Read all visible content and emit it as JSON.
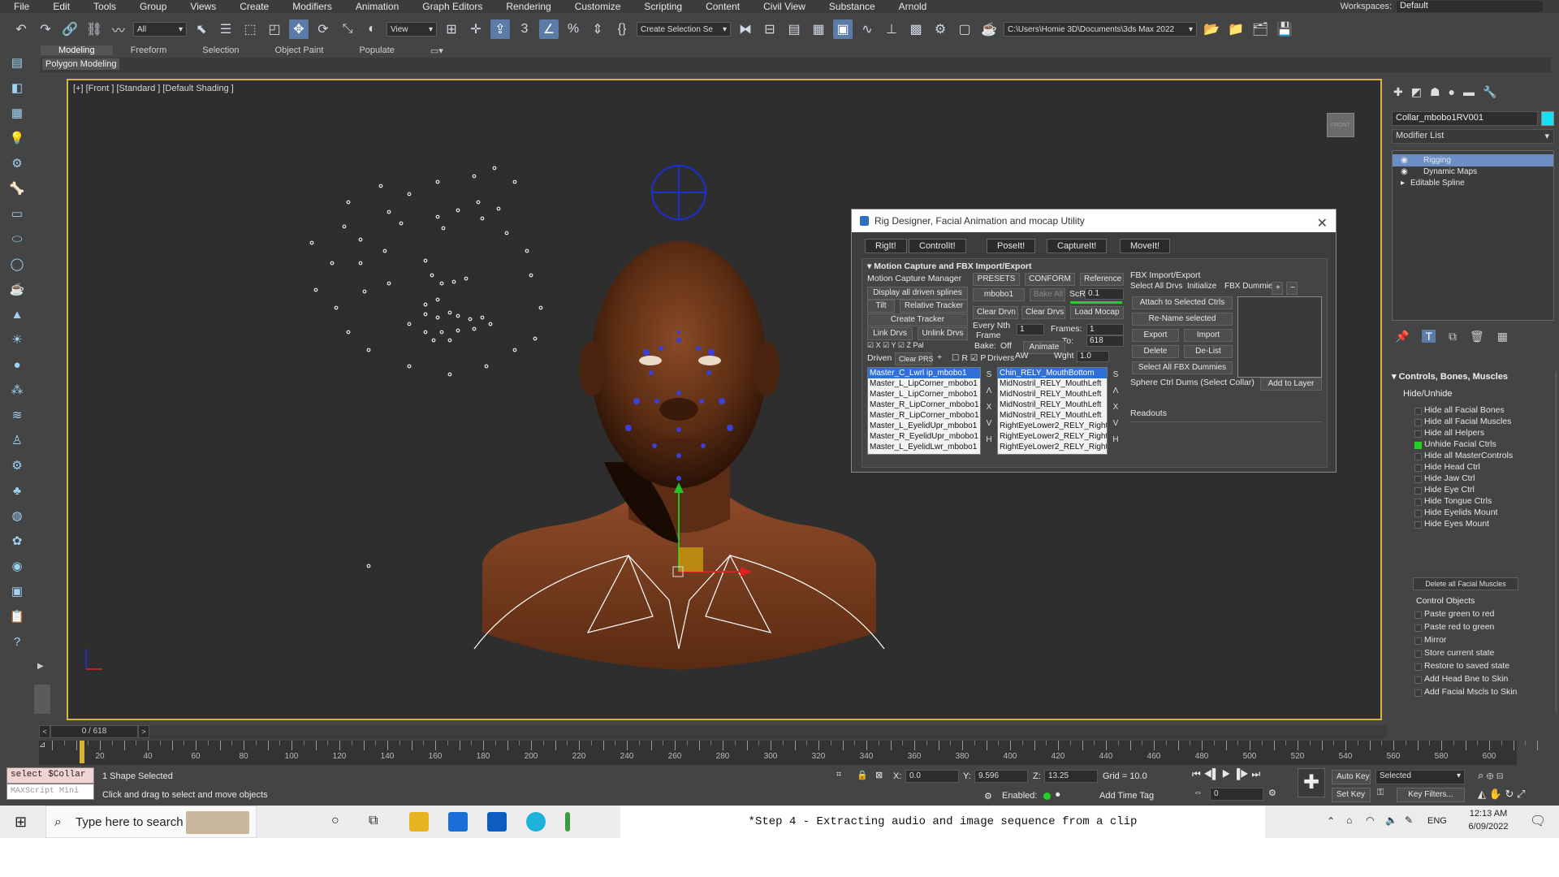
{
  "menu": [
    "File",
    "Edit",
    "Tools",
    "Group",
    "Views",
    "Create",
    "Modifiers",
    "Animation",
    "Graph Editors",
    "Rendering",
    "Customize",
    "Scripting",
    "Content",
    "Civil View",
    "Substance",
    "Arnold"
  ],
  "workspace": {
    "label": "Workspaces:",
    "value": "Default"
  },
  "toolbar": {
    "filter_value": "All",
    "refcoord_value": "View",
    "selection_set_placeholder": "Create Selection Se",
    "project_path": "C:\\Users\\Homie 3D\\Documents\\3ds Max 2022"
  },
  "ribbon": {
    "tabs": [
      "Modeling",
      "Freeform",
      "Selection",
      "Object Paint",
      "Populate"
    ],
    "active_tab": "Modeling",
    "sub_label": "Polygon Modeling"
  },
  "viewport": {
    "label": "[+] [Front ] [Standard ] [Default Shading ]",
    "viewcube_label": "FRONT"
  },
  "timeline": {
    "frame_display": "0 / 618",
    "ruler_labels": [
      "20",
      "40",
      "60",
      "80",
      "100",
      "120",
      "140",
      "160",
      "180",
      "200",
      "220",
      "240",
      "260",
      "280",
      "300",
      "320",
      "340",
      "360",
      "380",
      "400",
      "420",
      "440",
      "460",
      "480",
      "500",
      "520",
      "540",
      "560",
      "580",
      "600"
    ]
  },
  "status": {
    "maxscript_input": "select $Collar",
    "maxscript_placeholder": "MAXScript Mini",
    "selection_text": "1 Shape Selected",
    "prompt_text": "Click and drag to select and move objects",
    "x_label": "X:",
    "x_value": "0.0",
    "y_label": "Y:",
    "y_value": "9.596",
    "z_label": "Z:",
    "z_value": "13.25",
    "grid_text": "Grid = 10.0",
    "enabled_label": "Enabled:",
    "add_time_tag": "Add Time Tag",
    "frame_value": "0",
    "auto_key": "Auto Key",
    "set_key": "Set Key",
    "selected_value": "Selected",
    "key_filters": "Key Filters..."
  },
  "command_panel": {
    "object_name": "Collar_mbobo1RV001",
    "object_color": "#19e0f0",
    "modifier_list": "Modifier List",
    "stack": [
      {
        "label": "Rigging",
        "selected": true
      },
      {
        "label": "Dynamic Maps",
        "selected": false
      },
      {
        "label": "Editable Spline",
        "selected": false
      }
    ],
    "rollout_title": "Controls, Bones, Muscles",
    "hide_unhide_label": "Hide/Unhide",
    "hide_items": [
      {
        "label": "Hide all Facial Bones",
        "checked": false
      },
      {
        "label": "Hide all Facial Muscles",
        "checked": false
      },
      {
        "label": "Hide all Helpers",
        "checked": false
      },
      {
        "label": "Unhide Facial Ctrls",
        "checked": true
      },
      {
        "label": "Hide all MasterControls",
        "checked": false
      },
      {
        "label": "Hide Head Ctrl",
        "checked": false
      },
      {
        "label": "Hide Jaw Ctrl",
        "checked": false
      },
      {
        "label": "Hide Eye Ctrl",
        "checked": false
      },
      {
        "label": "Hide Tongue Ctrls",
        "checked": false
      },
      {
        "label": "Hide Eyelids Mount",
        "checked": false
      },
      {
        "label": "Hide Eyes Mount",
        "checked": false
      }
    ],
    "delete_muscles_button": "Delete all Facial Muscles",
    "control_objects_label": "Control Objects",
    "control_items": [
      "Paste green to red",
      "Paste red to green",
      "Mirror",
      "Store current state",
      "Restore to saved state",
      "Add Head Bne to Skin",
      "Add Facial Mscls to Skin"
    ]
  },
  "dialog": {
    "title": "Rig Designer, Facial Animation and mocap Utility",
    "tabs": [
      "RigIt!",
      "ControlIt!",
      "PoseIt!",
      "CaptureIt!",
      "MoveIt!"
    ],
    "active_tab": "CaptureIt!",
    "section_title": "Motion Capture and FBX Import/Export",
    "mocap_manager_label": "Motion Capture Manager",
    "presets": "PRESETS",
    "conform": "CONFORM",
    "reference": "Reference",
    "display_splines": "Display all driven splines",
    "mbobo_button": "mbobo1",
    "bake_all": "Bake All",
    "scale_label": "ScR",
    "scale_value": "0.1",
    "tilt": "Tilt",
    "relative_tracker": "Relative Tracker",
    "clear_drvn": "Clear Drvn",
    "clear_drvs": "Clear Drvs",
    "load_mocap": "Load Mocap",
    "create_tracker": "Create Tracker",
    "every_nth": "Every Nth",
    "frame_label": "Frame",
    "nth_value": "1",
    "frames_label": "Frames:",
    "frames_value": "1",
    "to_label": "To:",
    "to_value": "618",
    "link_drvs": "Link Drvs",
    "unlink_drvs": "Unlink Drvs",
    "bake_label": "Bake:",
    "bake_value": "Off",
    "animate": "Animate",
    "axis_x": "X",
    "axis_y": "Y",
    "axis_z": "Z",
    "axis_pal": "Pal",
    "driven_label": "Driven",
    "clear_prs": "Clear PRS",
    "r_label": "R",
    "p_label": "P",
    "drivers_label": "Drivers",
    "aw": "AW",
    "wght_label": "Wght",
    "wght_value": "1.0",
    "driven_list": [
      "Master_C_Lwrl ip_mbobo1",
      "Master_L_LipCorner_mbobo1",
      "Master_L_LipCorner_mbobo1",
      "Master_R_LipCorner_mbobo1",
      "Master_R_LipCorner_mbobo1",
      "Master_L_EyelidUpr_mbobo1",
      "Master_R_EyelidUpr_mbobo1",
      "Master_L_EyelidLwr_mbobo1"
    ],
    "drivers_list": [
      "Chin_RELY_MouthBottom",
      "MidNostril_RELY_MouthLeft",
      "MidNostril_RELY_MouthLeft",
      "MidNostril_RELY_MouthLeft",
      "MidNostril_RELY_MouthLeft",
      "RightEyeLower2_RELY_Right",
      "RightEyeLower2_RELY_Right",
      "RightEyeLower2_RELY_Right"
    ],
    "list_side_chars": [
      "S",
      "Λ",
      "X",
      "V",
      "H"
    ],
    "fbx_title": "FBX Import/Export",
    "select_all_drvs": "Select All Drvs",
    "initialize": "Initialize",
    "fbx_dummies": "FBX Dummies",
    "attach_selected": "Attach to Selected Ctrls",
    "rename_selected": "Re-Name selected",
    "export": "Export",
    "import": "Import",
    "delete": "Delete",
    "delist": "De-List",
    "select_fbx_dummies": "Select All FBX Dummies",
    "sphere_ctrl": "Sphere Ctrl Dums (Select Collar)",
    "add_to_layer": "Add to Layer",
    "readouts": "Readouts"
  },
  "taskbar": {
    "search_placeholder": "Type here to search",
    "document_title": "*Step 4 - Extracting audio and image sequence from a clip",
    "language": "ENG",
    "time": "12:13 AM",
    "date": "6/09/2022"
  }
}
